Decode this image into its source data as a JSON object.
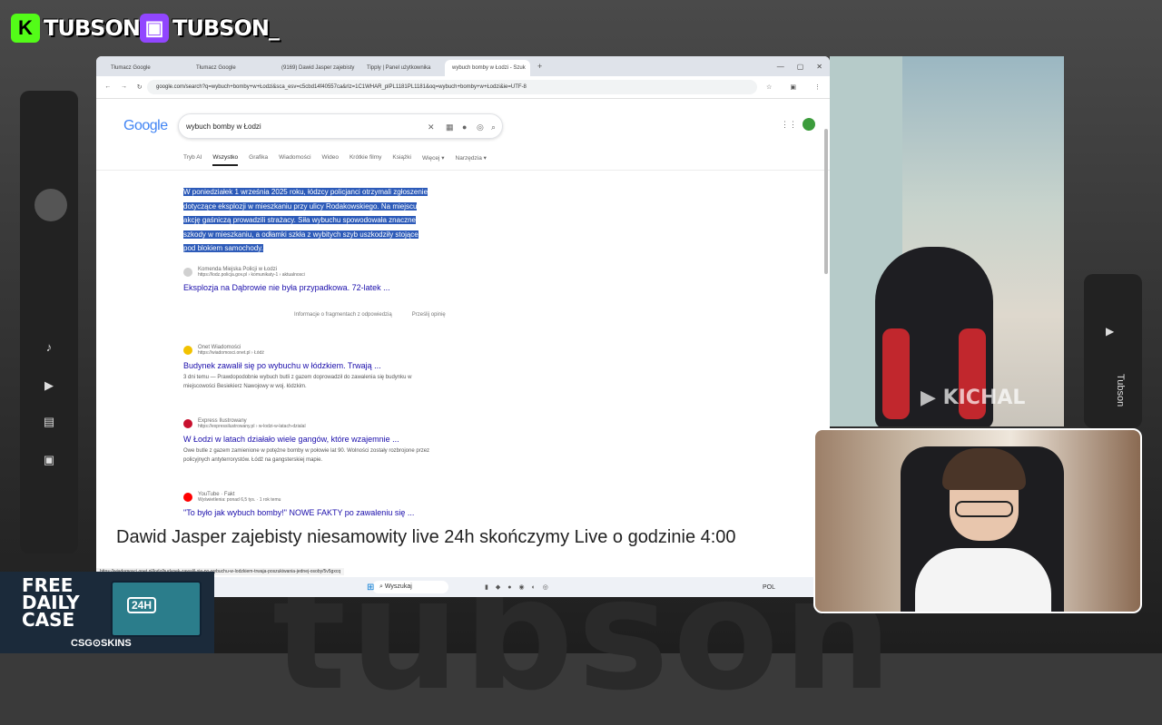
{
  "overlay": {
    "kick_name": "TUBSON",
    "twitch_name": "TUBSON_",
    "background_text": "tubson",
    "ticker": "Dawid Jasper zajebisty niesamowity live 24h skończymy Live o godzinie 4:00",
    "right_bar_label": "Tubson",
    "cam1_watermark": "KICHAL",
    "promo": {
      "line1": "FREE",
      "line2": "DAILY",
      "line3": "CASE",
      "box_label": "24H",
      "brand": "CSG⊙SKINS"
    }
  },
  "browser": {
    "tabs": [
      {
        "label": "Tłumacz Google"
      },
      {
        "label": "Tłumacz Google"
      },
      {
        "label": "(9169) Dawid Jasper zajebisty"
      },
      {
        "label": "Tipply | Panel użytkownika"
      },
      {
        "label": "wybuch bomby w Łodzi - Szuk"
      }
    ],
    "url": "google.com/search?q=wybuch+bomby+w+Łodzi&sca_esv=c5cbd14f40557ca&rlz=1C1WHAR_plPL1181PL1181&oq=wybuch+bomby+w+Łodzi&ie=UTF-8"
  },
  "google": {
    "logo": "Google",
    "query": "wybuch bomby w Łodzi",
    "nav": [
      "Tryb AI",
      "Wszystko",
      "Grafika",
      "Wiadomości",
      "Wideo",
      "Krótkie filmy",
      "Książki",
      "Więcej ▾",
      "Narzędzia ▾"
    ],
    "snippet": "W poniedziałek 1 września 2025 roku, łódzcy policjanci otrzymali zgłoszenie dotyczące eksplozji w mieszkaniu przy ulicy Rodakowskiego. Na miejscu akcję gaśniczą prowadzili strażacy. Siła wybuchu spowodowała znaczne szkody w mieszkaniu, a odłamki szkła z wybitych szyb uszkodziły stojące pod blokiem samochody.",
    "feedback_left": "Informacje o fragmentach z odpowiedzią",
    "feedback_right": "Prześlij opinię",
    "results": [
      {
        "source": "Komenda Miejska Policji w Łodzi",
        "url": "https://lodz.policja.gov.pl › komunikaty-1 › aktualnosci",
        "title": "Eksplozja na Dąbrowie nie była przypadkowa. 72-latek ...",
        "desc": ""
      },
      {
        "source": "Onet Wiadomości",
        "url": "https://wiadomosci.onet.pl › Łódź",
        "title": "Budynek zawalił się po wybuchu w łódzkiem. Trwają ...",
        "desc": "3 dni temu — Prawdopodobnie wybuch butli z gazem doprowadził do zawalenia się budynku w miejscowości Besiekierz Nawojowy w woj. łódzkim."
      },
      {
        "source": "Express Ilustrowany",
        "url": "https://expressilustrowany.pl › w-lodzi-w-latach-dzialal",
        "title": "W Łodzi w latach działało wiele gangów, które wzajemnie ...",
        "desc": "Owe butle z gazem zamienione w potężne bomby w połowie lat 90. Wolności zostały rozbrojone przez policyjnych antyterrorystów. Łódź na gangsterskiej mapie."
      },
      {
        "source": "YouTube · Fakt",
        "url": "Wyświetlenia: ponad 6,5 tys. · 1 rok temu",
        "title": "\"To było jak wybuch bomby!\" NOWE FAKTY po zawaleniu się ...",
        "desc": ""
      }
    ],
    "status_url": "https://wiadomosci.onet.pl/lodz/budynek-zawalil-sie-po-wybuchu-w-lodzkiem-trwaja-poszukiwania-jednej-osoby/5v5gxcq",
    "taskbar_search": "Wyszukaj",
    "taskbar_lang": "POL"
  },
  "colors": {
    "highlight": "#2d5bb9",
    "link": "#1a0dab",
    "kick": "#53fc18",
    "twitch": "#9146ff"
  }
}
